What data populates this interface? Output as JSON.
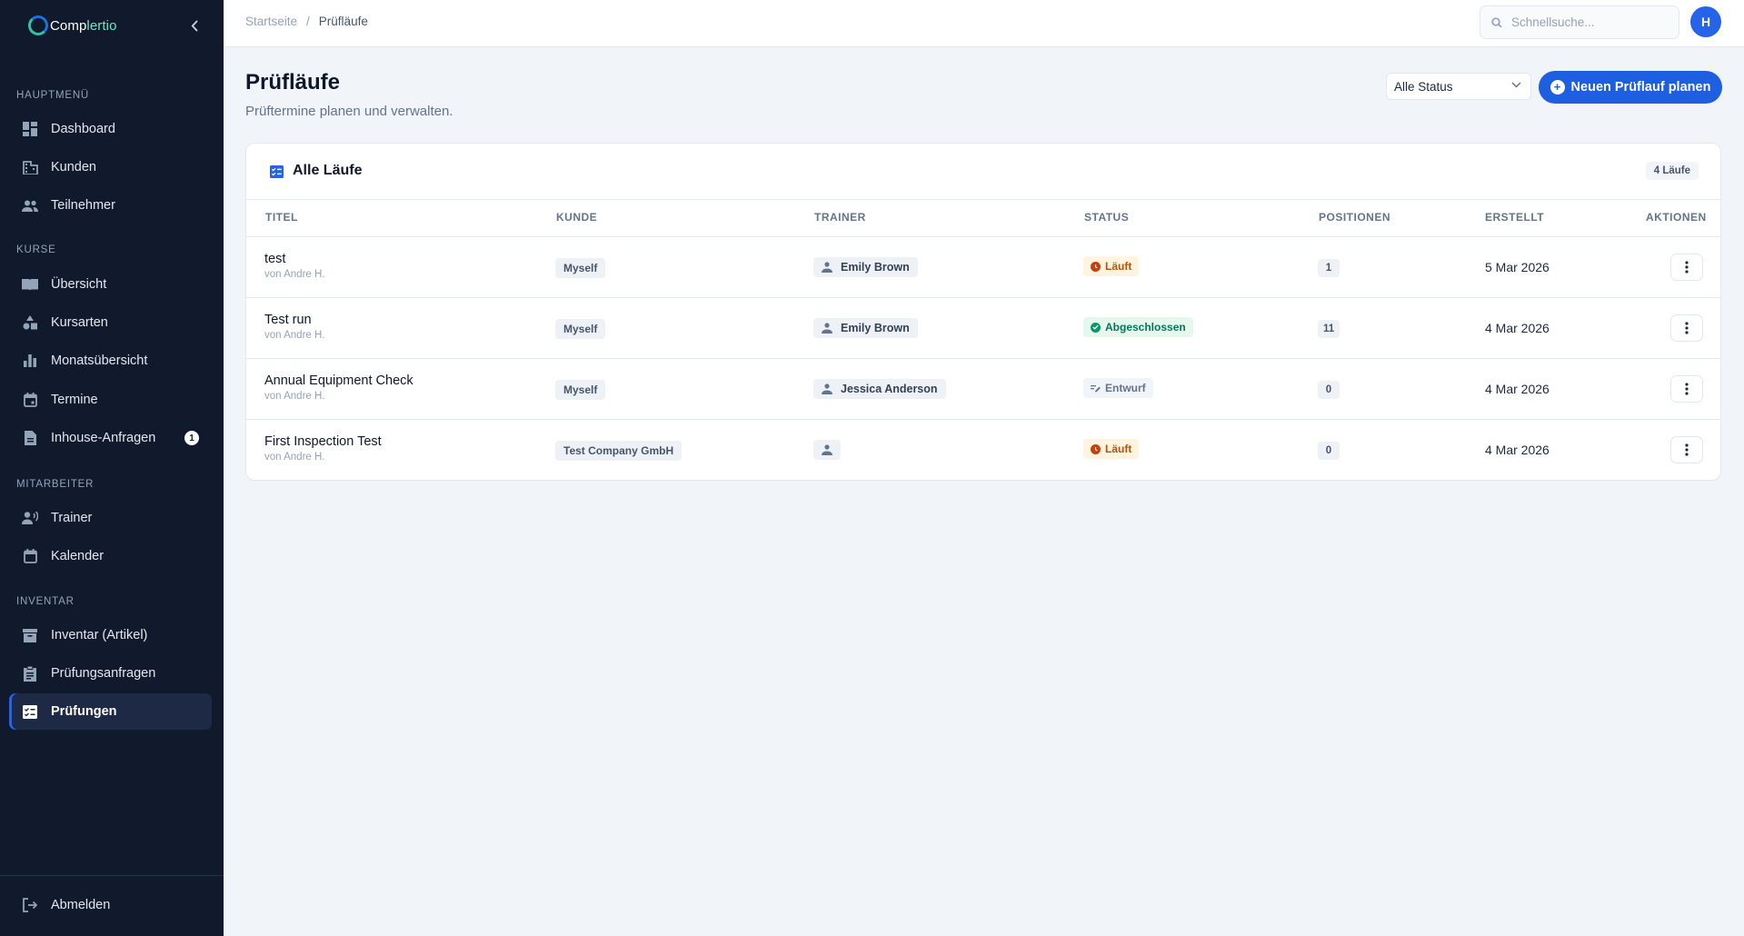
{
  "brand": {
    "name_part1": "Comp",
    "name_part2": "lertio"
  },
  "sidebar": {
    "sections": [
      {
        "title": "HAUPTMENÜ",
        "items": [
          {
            "label": "Dashboard",
            "icon": "dashboard-icon"
          },
          {
            "label": "Kunden",
            "icon": "building-icon"
          },
          {
            "label": "Teilnehmer",
            "icon": "people-icon"
          }
        ]
      },
      {
        "title": "KURSE",
        "items": [
          {
            "label": "Übersicht",
            "icon": "book-icon"
          },
          {
            "label": "Kursarten",
            "icon": "shapes-icon"
          },
          {
            "label": "Monatsübersicht",
            "icon": "bar-chart-icon"
          },
          {
            "label": "Termine",
            "icon": "calendar-event-icon"
          },
          {
            "label": "Inhouse-Anfragen",
            "icon": "document-icon",
            "badge": "1"
          }
        ]
      },
      {
        "title": "MITARBEITER",
        "items": [
          {
            "label": "Trainer",
            "icon": "trainer-icon"
          },
          {
            "label": "Kalender",
            "icon": "calendar-icon"
          }
        ]
      },
      {
        "title": "INVENTAR",
        "items": [
          {
            "label": "Inventar (Artikel)",
            "icon": "archive-icon"
          },
          {
            "label": "Prüfungsanfragen",
            "icon": "clipboard-icon"
          },
          {
            "label": "Prüfungen",
            "icon": "checklist-icon",
            "active": true
          }
        ]
      }
    ],
    "logout_label": "Abmelden"
  },
  "topbar": {
    "breadcrumb": [
      "Startseite",
      "/",
      "Prüfläufe"
    ],
    "search_placeholder": "Schnellsuche...",
    "avatar_initial": "H"
  },
  "page": {
    "title": "Prüfläufe",
    "subtitle": "Prüftermine planen und verwalten.",
    "status_filter": "Alle Status",
    "new_button": "Neuen Prüflauf planen"
  },
  "card": {
    "title": "Alle Läufe",
    "count": "4 Läufe",
    "columns": [
      "TITEL",
      "KUNDE",
      "TRAINER",
      "STATUS",
      "POSITIONEN",
      "ERSTELLT",
      "AKTIONEN"
    ],
    "rows": [
      {
        "title": "test",
        "by": "von Andre H.",
        "customer": "Myself",
        "trainer": "Emily Brown",
        "status": "Läuft",
        "status_type": "running",
        "positions": "1",
        "created": "5 Mar 2026"
      },
      {
        "title": "Test run",
        "by": "von Andre H.",
        "customer": "Myself",
        "trainer": "Emily Brown",
        "status": "Abgeschlossen",
        "status_type": "done",
        "positions": "11",
        "created": "4 Mar 2026"
      },
      {
        "title": "Annual Equipment Check",
        "by": "von Andre H.",
        "customer": "Myself",
        "trainer": "Jessica Anderson",
        "status": "Entwurf",
        "status_type": "draft",
        "positions": "0",
        "created": "4 Mar 2026"
      },
      {
        "title": "First Inspection Test",
        "by": "von Andre H.",
        "customer": "Test Company GmbH",
        "trainer": "",
        "status": "Läuft",
        "status_type": "running",
        "positions": "0",
        "created": "4 Mar 2026"
      }
    ]
  },
  "colors": {
    "sidebar_bg": "#111a2c",
    "accent": "#1d5fe0",
    "running": "#b45309",
    "done": "#047857"
  }
}
